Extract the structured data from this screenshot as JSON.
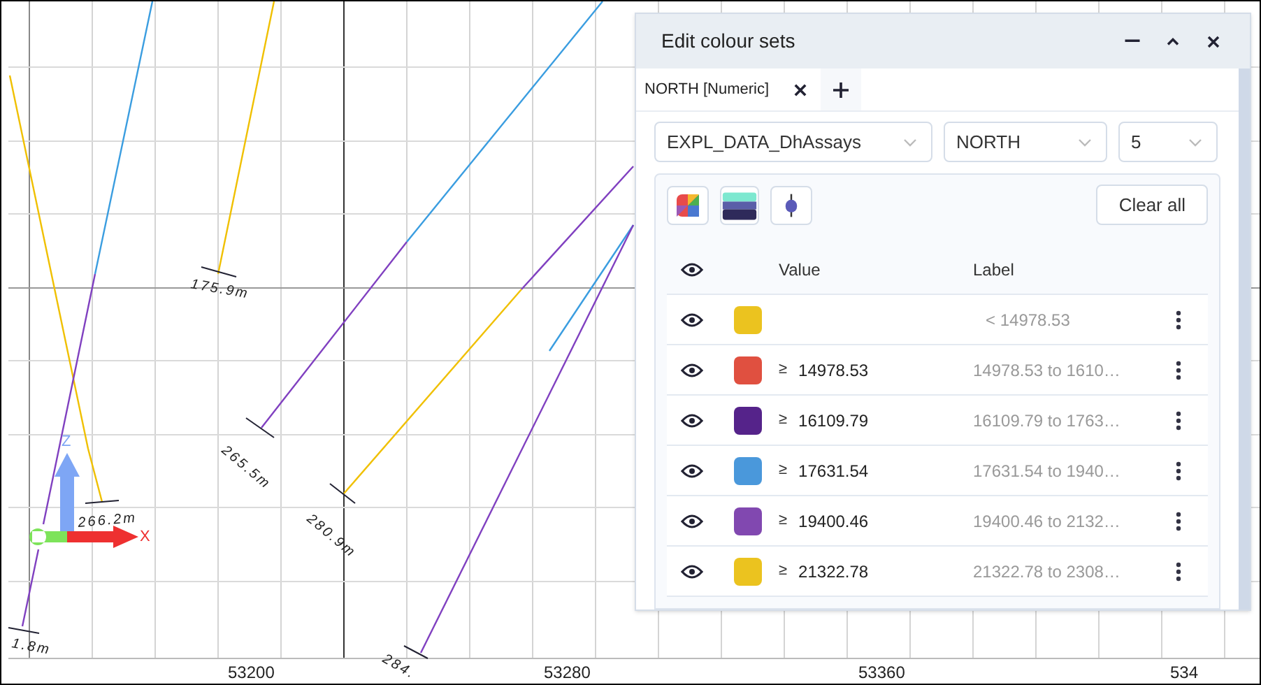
{
  "viewport": {
    "axis_labels": [
      "53200",
      "53280",
      "53360",
      "534"
    ],
    "depth_labels": [
      "175.9m",
      "265.5m",
      "280.9m",
      "266.2m",
      "1.8m",
      "284."
    ],
    "gizmo": {
      "z_label": "Z",
      "x_label": "X"
    }
  },
  "panel": {
    "title": "Edit colour sets",
    "tabs": [
      {
        "label": "NORTH [Numeric]",
        "selected": true
      }
    ],
    "dropdowns": [
      "EXPL_DATA_DhAssays",
      "NORTH",
      "5"
    ],
    "clear_button": "Clear all",
    "table": {
      "columns": [
        "Value",
        "Label"
      ],
      "rows": [
        {
          "visible": true,
          "color": "#ebc31f",
          "label": "< 14978.53"
        },
        {
          "visible": true,
          "color": "#e05040",
          "prefix": "≥",
          "value": "14978.53",
          "label": "14978.53 to 1610…"
        },
        {
          "visible": true,
          "color": "#55238a",
          "prefix": "≥",
          "value": "16109.79",
          "label": "16109.79 to 1763…"
        },
        {
          "visible": true,
          "color": "#4a98db",
          "prefix": "≥",
          "value": "17631.54",
          "label": "17631.54 to 1940…"
        },
        {
          "visible": true,
          "color": "#8148b0",
          "prefix": "≥",
          "value": "19400.46",
          "label": "19400.46 to 2132…"
        },
        {
          "visible": true,
          "color": "#ebc31f",
          "prefix": "≥",
          "value": "21322.78",
          "label": "21322.78 to 2308…"
        }
      ]
    }
  }
}
